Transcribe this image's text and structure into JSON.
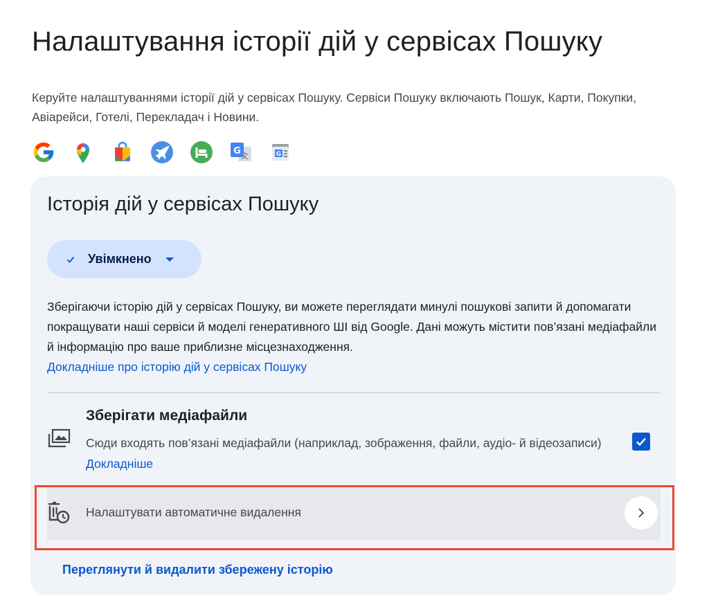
{
  "page": {
    "title": "Налаштування історії дій у сервісах Пошуку",
    "intro": "Керуйте налаштуваннями історії дій у сервісах Пошуку. Сервіси Пошуку включають Пошук, Карти, Покупки, Авіарейси, Готелі, Перекладач і Новини.",
    "product_icons": [
      "google-search-icon",
      "google-maps-pin-icon",
      "google-shopping-bag-icon",
      "flights-plane-icon",
      "hotels-bed-icon",
      "google-translate-icon",
      "google-news-icon"
    ]
  },
  "card": {
    "title": "Історія дій у сервісах Пошуку",
    "status": {
      "label": "Увімкнено",
      "icon": "check-icon"
    },
    "description": "Зберігаючи історію дій у сервісах Пошуку, ви можете переглядати минулі пошукові запити й допомагати покращувати наші сервіси й моделі генеративного ШІ від Google. Дані можуть містити пов’язані медіафайли й інформацію про ваше приблизне місцезнаходження.",
    "learn_more_link": "Докладніше про історію дій у сервісах Пошуку",
    "media": {
      "title": "Зберігати медіафайли",
      "description": "Сюди входять пов’язані медіафайли (наприклад, зображення, файли, аудіо- й відеозаписи)",
      "learn_more": "Докладніше",
      "checked": true
    },
    "auto_delete": {
      "label": "Налаштувати автоматичне видалення"
    },
    "view_history_link": "Переглянути й видалити збережену історію"
  },
  "colors": {
    "accent": "#0b57d0",
    "card_background": "#f0f4f9",
    "chip_background": "#d3e3fd",
    "highlight": "#ea4a2f"
  }
}
